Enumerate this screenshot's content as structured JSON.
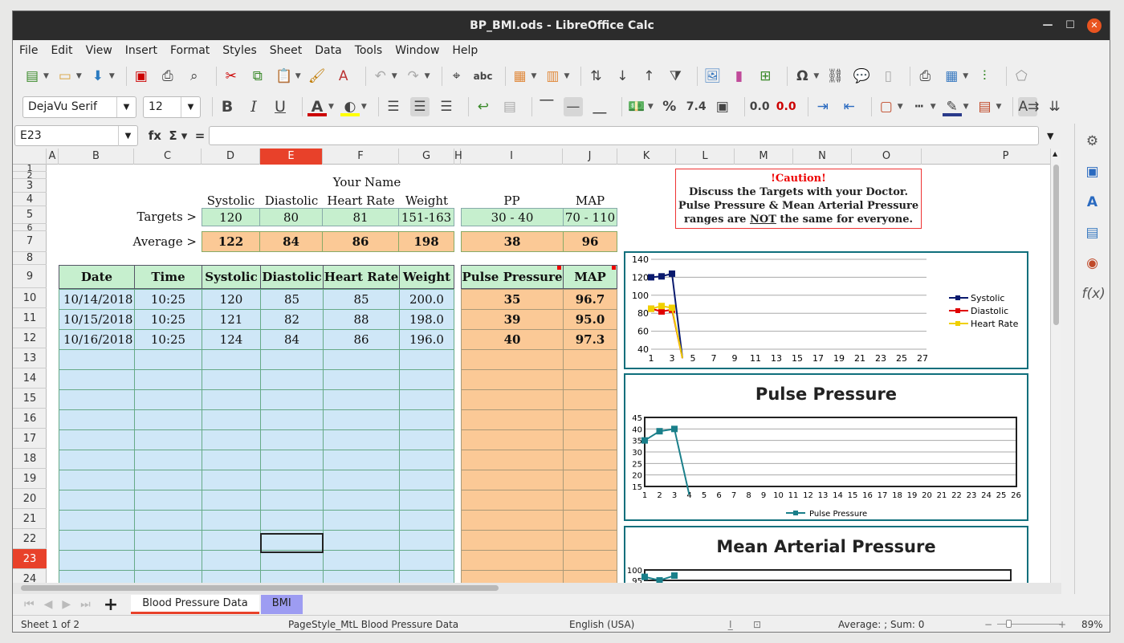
{
  "window": {
    "title": "BP_BMI.ods - LibreOffice Calc"
  },
  "menu": [
    "File",
    "Edit",
    "View",
    "Insert",
    "Format",
    "Styles",
    "Sheet",
    "Data",
    "Tools",
    "Window",
    "Help"
  ],
  "toolbar2": {
    "font": "DejaVu Serif",
    "size": "12"
  },
  "formula": {
    "cell_ref": "E23",
    "value": ""
  },
  "columns": [
    "A",
    "B",
    "C",
    "D",
    "E",
    "F",
    "G",
    "H",
    "I",
    "J",
    "K",
    "L",
    "M",
    "N",
    "O",
    "P"
  ],
  "rows": [
    "1",
    "2",
    "3",
    "4",
    "5",
    "6",
    "7",
    "8",
    "9",
    "10",
    "11",
    "12",
    "13",
    "14",
    "15",
    "16",
    "17",
    "18",
    "19",
    "20",
    "21",
    "22",
    "23",
    "24"
  ],
  "sheet": {
    "name_label": "Your Name",
    "headers_row4": [
      "Systolic",
      "Diastolic",
      "Heart Rate",
      "Weight",
      "PP",
      "MAP"
    ],
    "targets_label": "Targets >",
    "targets": [
      "120",
      "80",
      "81",
      "151-163",
      "30 - 40",
      "70 - 110"
    ],
    "average_label": "Average >",
    "averages": [
      "122",
      "84",
      "86",
      "198",
      "38",
      "96"
    ],
    "table_headers": [
      "Date",
      "Time",
      "Systolic",
      "Diastolic",
      "Heart Rate",
      "Weight",
      "Pulse Pressure",
      "MAP"
    ],
    "data": [
      [
        "10/14/2018",
        "10:25",
        "120",
        "85",
        "85",
        "200.0",
        "35",
        "96.7"
      ],
      [
        "10/15/2018",
        "10:25",
        "121",
        "82",
        "88",
        "198.0",
        "39",
        "95.0"
      ],
      [
        "10/16/2018",
        "10:25",
        "124",
        "84",
        "86",
        "196.0",
        "40",
        "97.3"
      ]
    ]
  },
  "caution": {
    "title": "!Caution!",
    "line1": "Discuss the Targets with your Doctor.",
    "line2": "Pulse Pressure & Mean Arterial Pressure",
    "line3a": "ranges are ",
    "line3b": "NOT",
    "line3c": " the same for everyone."
  },
  "chart_data": [
    {
      "type": "line",
      "title": "",
      "x": [
        1,
        2,
        3,
        4
      ],
      "series": [
        {
          "name": "Systolic",
          "values": [
            120,
            121,
            124,
            30
          ]
        },
        {
          "name": "Diastolic",
          "values": [
            85,
            82,
            84,
            30
          ]
        },
        {
          "name": "Heart Rate",
          "values": [
            85,
            88,
            86,
            30
          ]
        }
      ],
      "ylim": [
        40,
        140
      ],
      "yticks": [
        "140",
        "120",
        "100",
        "80",
        "60",
        "40"
      ],
      "xticks": [
        "1",
        "3",
        "5",
        "7",
        "9",
        "11",
        "13",
        "15",
        "17",
        "19",
        "21",
        "23",
        "25",
        "27"
      ],
      "colors": [
        "#0a1a6e",
        "#e00000",
        "#f0d000"
      ]
    },
    {
      "type": "line",
      "title": "Pulse Pressure",
      "x": [
        1,
        2,
        3,
        4
      ],
      "series": [
        {
          "name": "Pulse Pressure",
          "values": [
            35,
            39,
            40,
            0
          ]
        }
      ],
      "ylim": [
        15,
        45
      ],
      "yticks": [
        "45",
        "40",
        "35",
        "30",
        "25",
        "20",
        "15"
      ],
      "xticks": [
        "1",
        "2",
        "3",
        "4",
        "5",
        "6",
        "7",
        "8",
        "9",
        "10",
        "11",
        "12",
        "13",
        "14",
        "15",
        "16",
        "17",
        "18",
        "19",
        "20",
        "21",
        "22",
        "23",
        "24",
        "25",
        "26"
      ],
      "colors": [
        "#1a7f8a"
      ]
    },
    {
      "type": "line",
      "title": "Mean Arterial Pressure",
      "x": [
        1,
        2,
        3
      ],
      "series": [
        {
          "values": [
            96.7,
            95.0,
            97.3
          ]
        }
      ],
      "ylim": [
        95,
        100
      ],
      "yticks": [
        "100",
        "95"
      ],
      "colors": [
        "#1a7f8a"
      ]
    }
  ],
  "tabs": [
    "Blood Pressure Data",
    "BMI"
  ],
  "status": {
    "sheet": "Sheet 1 of 2",
    "pagestyle": "PageStyle_MtL Blood Pressure Data",
    "lang": "English (USA)",
    "sum": "Average: ; Sum: 0",
    "zoom": "89%"
  }
}
